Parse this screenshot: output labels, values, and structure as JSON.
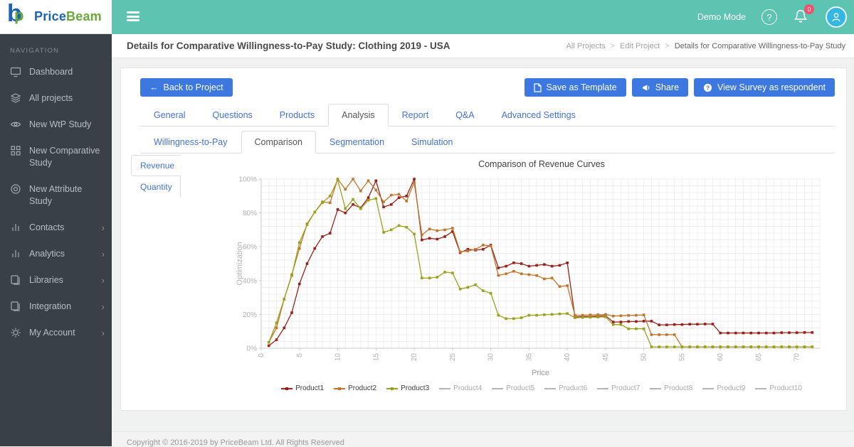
{
  "brand": {
    "price": "Price",
    "beam": "Beam"
  },
  "header": {
    "demo_mode_label": "Demo Mode",
    "notification_count": "0"
  },
  "sidebar": {
    "section_label": "NAVIGATION",
    "items": [
      {
        "label": "Dashboard",
        "icon": "dashboard",
        "has_children": false
      },
      {
        "label": "All projects",
        "icon": "layers",
        "has_children": false
      },
      {
        "label": "New WtP Study",
        "icon": "eye",
        "has_children": false
      },
      {
        "label": "New Comparative Study",
        "icon": "grid",
        "has_children": false
      },
      {
        "label": "New Attribute Study",
        "icon": "target",
        "has_children": false
      },
      {
        "label": "Contacts",
        "icon": "bars",
        "has_children": true
      },
      {
        "label": "Analytics",
        "icon": "bars",
        "has_children": true
      },
      {
        "label": "Libraries",
        "icon": "copy",
        "has_children": true
      },
      {
        "label": "Integration",
        "icon": "copy",
        "has_children": true
      },
      {
        "label": "My Account",
        "icon": "gear",
        "has_children": true
      }
    ]
  },
  "page": {
    "title": "Details for Comparative Willingness-to-Pay Study: Clothing 2019 - USA",
    "breadcrumb": [
      "All Projects",
      "Edit Project",
      "Details for Comparative Willingness-to-Pay Study"
    ]
  },
  "toolbar": {
    "back_label": "Back to Project",
    "save_template_label": "Save as Template",
    "share_label": "Share",
    "view_survey_label": "View Survey as respondent"
  },
  "tabs": {
    "main": [
      "General",
      "Questions",
      "Products",
      "Analysis",
      "Report",
      "Q&A",
      "Advanced Settings"
    ],
    "active_main": "Analysis",
    "analysis": [
      "Willingness-to-Pay",
      "Comparison",
      "Segmentation",
      "Simulation"
    ],
    "active_analysis": "Comparison",
    "view": [
      "Revenue",
      "Quantity"
    ],
    "active_view": "Revenue"
  },
  "chart_data": {
    "type": "line",
    "title": "Comparison of Revenue Curves",
    "xlabel": "Price",
    "ylabel": "Optimization",
    "x_min": 0,
    "x_max": 73,
    "x_tick_step": 5,
    "y_ticks_percent": [
      0,
      20,
      40,
      60,
      80,
      100
    ],
    "grid": true,
    "legend_position": "bottom",
    "series": [
      {
        "name": "Product1",
        "color": "#98211a",
        "active": true,
        "x_start": 1,
        "values": [
          1.5,
          5,
          12,
          21,
          38,
          50,
          59,
          66,
          68,
          82,
          80,
          85,
          83,
          89,
          99,
          83.5,
          85,
          89,
          90,
          100,
          64,
          65,
          64.5,
          66,
          69,
          56.5,
          58.5,
          58,
          58.5,
          61,
          47.5,
          48.5,
          50.5,
          50,
          48.5,
          49,
          49.5,
          48.5,
          49,
          50.5,
          18.5,
          18.7,
          18.8,
          19,
          19.2,
          15.5,
          15.5,
          15.8,
          15.8,
          16,
          16,
          13.8,
          13.8,
          14,
          14,
          14.2,
          14.2,
          14.3,
          14.3,
          9,
          9,
          9,
          9,
          9,
          9,
          9,
          9,
          9.2,
          9.2,
          9.2,
          9.3,
          9.3
        ]
      },
      {
        "name": "Product2",
        "color": "#c0762b",
        "active": true,
        "x_start": 1,
        "values": [
          3.5,
          12,
          29,
          43.5,
          59,
          73.5,
          80.5,
          86.5,
          86,
          100,
          94,
          100,
          93,
          99,
          93.5,
          86.5,
          90.5,
          91,
          87,
          98,
          67,
          70.5,
          69.5,
          70,
          71,
          57,
          57.5,
          58.5,
          61,
          60.5,
          43,
          44,
          45.5,
          44,
          43.5,
          43,
          41,
          41.5,
          36.5,
          37,
          19.5,
          19.5,
          19.7,
          19.8,
          20,
          19,
          19.2,
          19.4,
          19.5,
          19.7,
          8,
          8,
          8,
          8,
          0.8,
          0.8,
          0.8,
          0.8,
          0.8,
          0.8,
          0.8,
          0.8,
          0.8,
          0.8,
          0.8,
          0.8,
          0.8,
          0.8,
          0.8,
          0.8,
          0.8,
          0.8
        ]
      },
      {
        "name": "Product3",
        "color": "#9aa11b",
        "active": true,
        "x_start": 1,
        "values": [
          3.5,
          15,
          29,
          43,
          62.5,
          73,
          80.5,
          86,
          90,
          99.5,
          82.5,
          88,
          82.5,
          87.5,
          88.5,
          68.5,
          70,
          72.5,
          71.5,
          67.5,
          41.5,
          41.5,
          42,
          45,
          44.5,
          35,
          36,
          37.5,
          34,
          32.5,
          19.5,
          17.5,
          17.5,
          18,
          19.5,
          19.5,
          19.8,
          20,
          20.3,
          20.5,
          18,
          18.2,
          18.3,
          18.4,
          18.5,
          14,
          14,
          11.5,
          11.5,
          11.5,
          0.8,
          0.8,
          0.8,
          0.8,
          0.8,
          0.8,
          0.8,
          0.8,
          0.8,
          0.8,
          0.8,
          0.8,
          0.8,
          0.8,
          0.8,
          0.8,
          0.8,
          0.8,
          0.8,
          0.8,
          0.8,
          0.8
        ]
      },
      {
        "name": "Product4",
        "color": "#b3b3b3",
        "active": false,
        "values": []
      },
      {
        "name": "Product5",
        "color": "#b3b3b3",
        "active": false,
        "values": []
      },
      {
        "name": "Product6",
        "color": "#b3b3b3",
        "active": false,
        "values": []
      },
      {
        "name": "Product7",
        "color": "#b3b3b3",
        "active": false,
        "values": []
      },
      {
        "name": "Product8",
        "color": "#b3b3b3",
        "active": false,
        "values": []
      },
      {
        "name": "Product9",
        "color": "#b3b3b3",
        "active": false,
        "values": []
      },
      {
        "name": "Product10",
        "color": "#b3b3b3",
        "active": false,
        "values": []
      }
    ]
  },
  "footer": {
    "copyright": "Copyright © 2016-2019 by PriceBeam Ltd. All Rights Reserved"
  }
}
